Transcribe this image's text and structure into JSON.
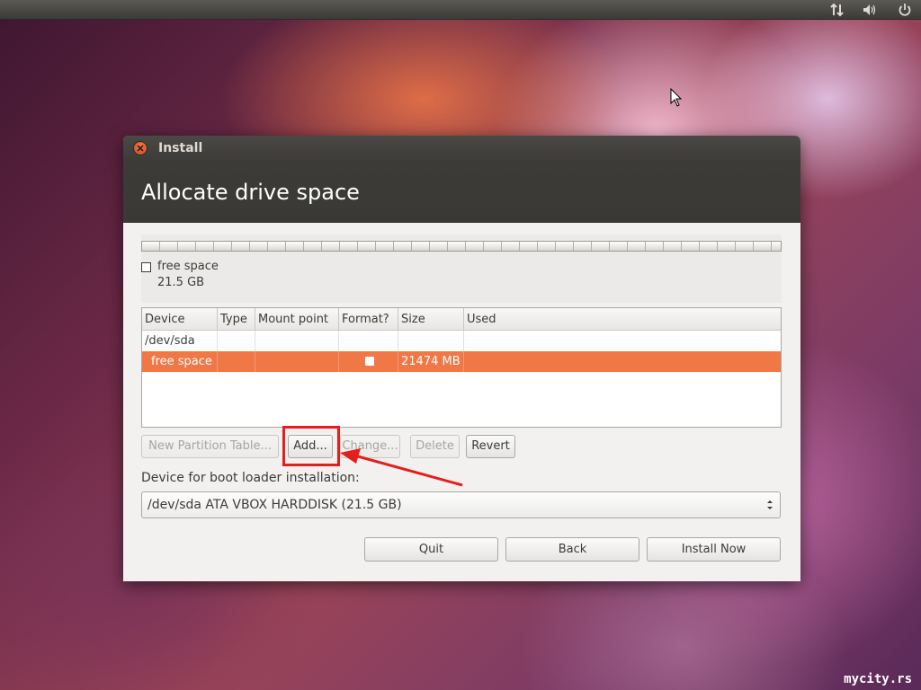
{
  "window": {
    "title": "Install",
    "heading": "Allocate drive space"
  },
  "partition_bar": {
    "legend_name": "free space",
    "legend_size": "21.5 GB"
  },
  "table": {
    "columns": [
      "Device",
      "Type",
      "Mount point",
      "Format?",
      "Size",
      "Used"
    ],
    "rows": [
      {
        "device": "/dev/sda",
        "type": "",
        "mount": "",
        "format": "",
        "size": "",
        "used": ""
      },
      {
        "device": "free space",
        "type": "",
        "mount": "",
        "format": "unchecked",
        "size": "21474 MB",
        "used": "",
        "selected": true
      }
    ]
  },
  "actions": {
    "new_partition_table": "New Partition Table...",
    "add": "Add...",
    "change": "Change...",
    "delete": "Delete",
    "revert": "Revert"
  },
  "boot_loader": {
    "label": "Device for boot loader installation:",
    "value": "/dev/sda ATA VBOX HARDDISK (21.5 GB)"
  },
  "footer": {
    "quit": "Quit",
    "back": "Back",
    "install_now": "Install Now"
  },
  "panel": {
    "icons": [
      "network-icon",
      "volume-icon",
      "power-icon"
    ]
  },
  "watermark": "mycity.rs",
  "colors": {
    "selection": "#f07746",
    "titlebar": "#3c3b37",
    "highlight": "#e41d1d"
  }
}
